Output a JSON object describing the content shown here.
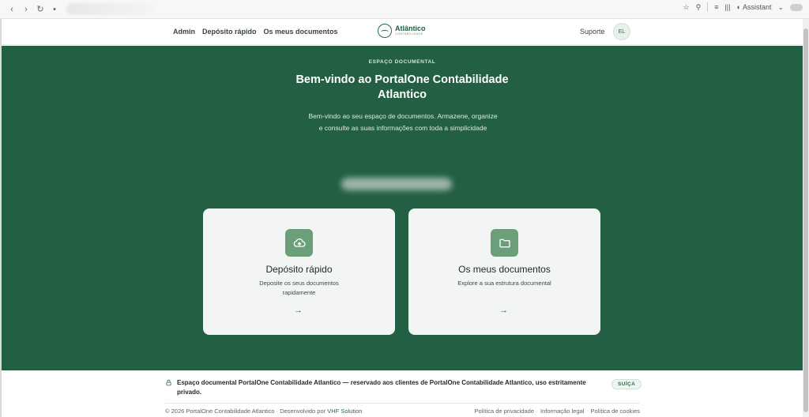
{
  "browser": {
    "assistant_label": "Assistant"
  },
  "header": {
    "nav": [
      "Admin",
      "Depósito rápido",
      "Os meus documentos"
    ],
    "logo_name": "Atlântico",
    "logo_sub": "CONTABILIDADE",
    "support": "Suporte",
    "avatar_initials": "EL"
  },
  "hero": {
    "eyebrow": "ESPAÇO DOCUMENTAL",
    "title": "Bem-vindo ao PortalOne Contabilidade Atlantico",
    "lead": "Bem-vindo ao seu espaço de documentos. Armazene, organize e consulte as suas informações com toda a simplicidade"
  },
  "cards": [
    {
      "title": "Depósito rápido",
      "desc": "Deposite os seus documentos rapidamente",
      "icon": "cloud-upload-icon"
    },
    {
      "title": "Os meus documentos",
      "desc": "Explore a sua estrutura documental",
      "icon": "folder-icon"
    }
  ],
  "footer": {
    "notice": "Espaço documental PortalOne Contabilidade Atlantico — reservado aos clientes de PortalOne Contabilidade Atlantico, uso estritamente privado.",
    "badge": "SUÍÇA",
    "copyright": "© 2026 PortalOne Contabilidade Atlantico · Desenvolvido por",
    "developer": "VHF Solution",
    "links": [
      "Política de privacidade",
      "Informação legal",
      "Política de cookies"
    ]
  },
  "colors": {
    "brand_green": "#235f42",
    "icon_green": "#6a9f7a",
    "card_bg": "#f3f5f4"
  }
}
